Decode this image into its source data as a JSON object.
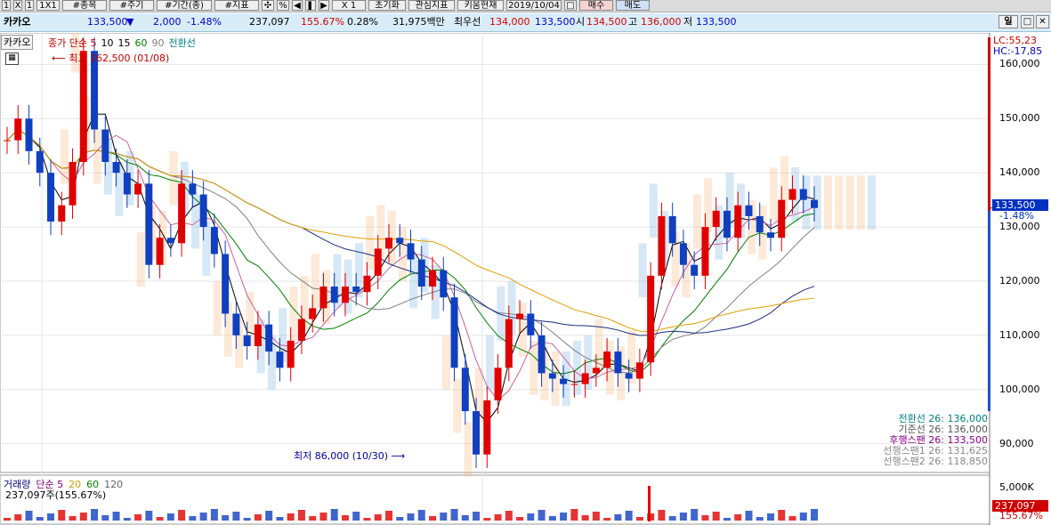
{
  "toolbar": {
    "items": [
      "1",
      "X",
      "1",
      "1X1",
      "#종목",
      "#주기",
      "#기간(종)",
      "#지표",
      "✣",
      "%",
      "◀",
      "❚❚",
      "▶",
      "X 1",
      "초기화",
      "관심지표",
      "키움현재",
      "2019/10/04",
      "□",
      "매수",
      "매도"
    ]
  },
  "info": {
    "name": "카카오",
    "price": "133,500",
    "arrow": "▼",
    "change": "2,000",
    "change_pct": "-1.48%",
    "volume": "237,097",
    "vol_ratio": "155.67%",
    "turnover": "0.28%",
    "amount": "31,975백만",
    "ask_label": "최우선",
    "ask": "134,000",
    "bid": "133,500",
    "open_label": "시",
    "open": "134,500",
    "high_label": "고",
    "high": "136,000",
    "low_label": "저",
    "low": "133,500",
    "period_btn": "일",
    "win_btn": "□",
    "close_btn": "✕"
  },
  "chart": {
    "tab": "카카오",
    "legend": [
      {
        "text": "종가 단순 5",
        "color": "#c00000"
      },
      {
        "text": "10",
        "color": "#000000"
      },
      {
        "text": "15",
        "color": "#000000"
      },
      {
        "text": "60",
        "color": "#008000"
      },
      {
        "text": "90",
        "color": "#808080"
      },
      {
        "text": "전환선",
        "color": "#008080"
      }
    ],
    "grid_icon": "▦",
    "max_label": "최고 162,500 (01/08)",
    "min_label": "최저 86,000 (10/30)",
    "lc": "LC:55,23",
    "hc": "HC:-17,85",
    "price_tag": "133,500",
    "price_tag_pct": "-1.48%",
    "right_notes": [
      {
        "text": "전환선 26: 136,000",
        "color": "#008080"
      },
      {
        "text": "기준선 26: 136,000",
        "color": "#555555"
      },
      {
        "text": "후행스팬 26: 133,500",
        "color": "#8b008b"
      },
      {
        "text": "선행스팬1 26: 131,625",
        "color": "#888888"
      },
      {
        "text": "선행스팬2 26: 118,850",
        "color": "#888888"
      }
    ],
    "volume_legend": [
      {
        "text": "거래량",
        "color": "#000080"
      },
      {
        "text": "단순 5",
        "color": "#800080"
      },
      {
        "text": "20",
        "color": "#c8a000"
      },
      {
        "text": "60",
        "color": "#008000"
      },
      {
        "text": "120",
        "color": "#606060"
      }
    ],
    "volume_value": "237,097주(155.67%)",
    "vol_axis": "5,000K",
    "vol_tag": "237,097",
    "vol_tag_pct": "155.67%",
    "colors": {
      "up": "#e00000",
      "down": "#1040c0",
      "cloud_up": "#f7b070",
      "cloud_down": "#6aaee0"
    }
  },
  "chart_data": {
    "type": "line",
    "title": "카카오",
    "ylim": [
      85000,
      165000
    ],
    "yticks": [
      "160,000",
      "150,000",
      "140,000",
      "130,000",
      "120,000",
      "110,000",
      "100,000",
      "90,000"
    ],
    "ytick_values": [
      160000,
      150000,
      140000,
      130000,
      120000,
      110000,
      100000,
      90000
    ],
    "series": [
      {
        "name": "종가",
        "values": [
          146000,
          150000,
          144000,
          140000,
          131000,
          134000,
          142000,
          162500,
          148000,
          142000,
          140000,
          136000,
          138000,
          123000,
          128000,
          127000,
          138000,
          136000,
          130000,
          125000,
          114000,
          110000,
          108000,
          112000,
          107000,
          104000,
          109000,
          113000,
          115000,
          119000,
          116000,
          119000,
          118000,
          121000,
          126000,
          128000,
          127000,
          124000,
          119000,
          122000,
          117000,
          104000,
          96000,
          88000,
          98000,
          104000,
          113000,
          114000,
          110000,
          103000,
          102000,
          101000,
          101000,
          103000,
          104000,
          107000,
          103000,
          102000,
          105000,
          121000,
          132000,
          127000,
          123000,
          121000,
          130000,
          133000,
          128000,
          134000,
          132000,
          129000,
          128000,
          135000,
          137000,
          135000,
          133500
        ]
      }
    ]
  }
}
